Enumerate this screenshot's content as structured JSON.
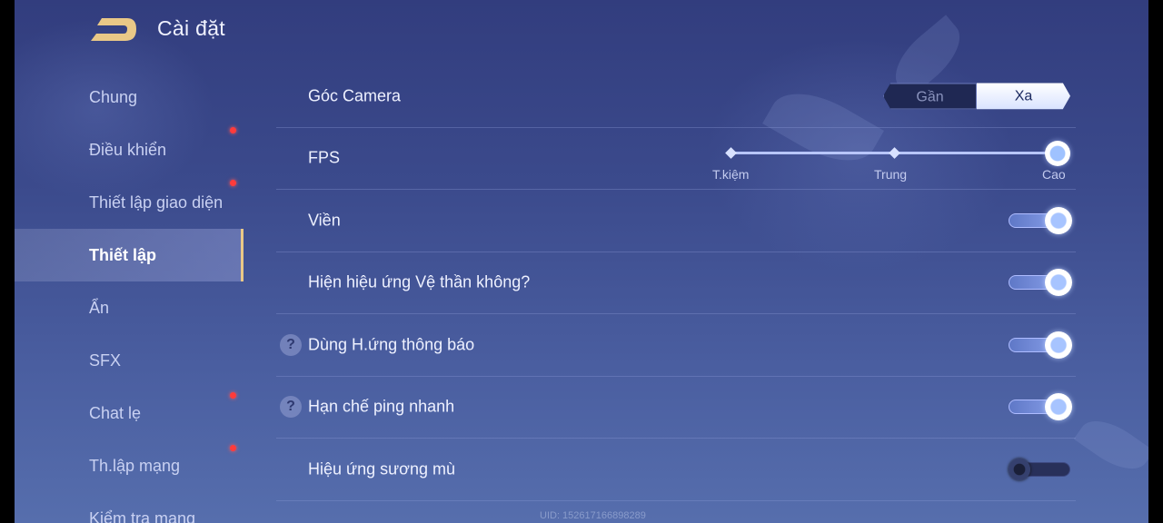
{
  "header": {
    "title": "Cài đặt"
  },
  "sidebar": {
    "items": [
      {
        "label": "Chung",
        "badge": false
      },
      {
        "label": "Điều khiển",
        "badge": true
      },
      {
        "label": "Thiết lập giao diện",
        "badge": true
      },
      {
        "label": "Thiết lập",
        "badge": false,
        "active": true
      },
      {
        "label": "Ẩn",
        "badge": false
      },
      {
        "label": "SFX",
        "badge": false
      },
      {
        "label": "Chat lẹ",
        "badge": true
      },
      {
        "label": "Th.lập mạng",
        "badge": true
      },
      {
        "label": "Kiểm tra mạng",
        "badge": false
      }
    ]
  },
  "settings": {
    "camera": {
      "label": "Góc Camera",
      "options": [
        "Gần",
        "Xa"
      ],
      "selected": "Xa"
    },
    "fps": {
      "label": "FPS",
      "levels": [
        "T.kiệm",
        "Trung",
        "Cao"
      ],
      "selected": "Cao"
    },
    "border": {
      "label": "Viền",
      "on": true
    },
    "guardian_effect": {
      "label": "Hiện hiệu ứng Vệ thần không?",
      "on": true
    },
    "notify_effect": {
      "label": "Dùng H.ứng thông báo",
      "on": true,
      "help": true
    },
    "ping_limit": {
      "label": "Hạn chế ping nhanh",
      "on": true,
      "help": true
    },
    "fog_effect": {
      "label": "Hiệu ứng sương mù",
      "on": false
    }
  },
  "footer": {
    "uid": "UID: 152617166898289"
  },
  "colors": {
    "accent_gold": "#e9c887",
    "badge_red": "#ff3b3b",
    "panel_bg": "#3b4a8c"
  }
}
